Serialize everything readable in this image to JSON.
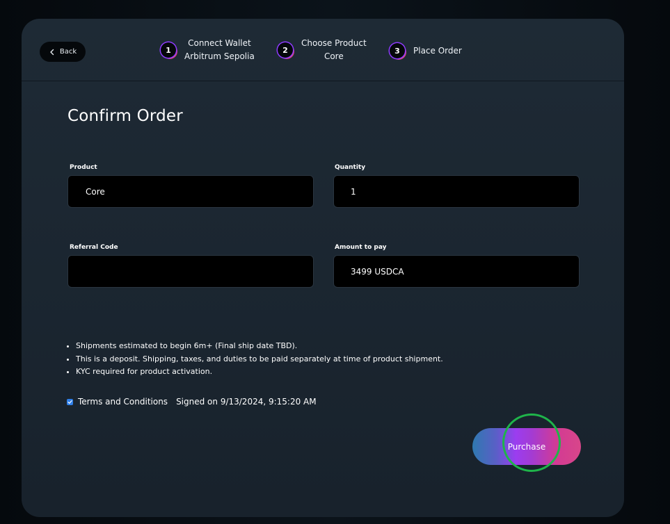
{
  "header": {
    "back_label": "Back",
    "steps": [
      {
        "number": "1",
        "line1": "Connect Wallet",
        "line2": "Arbitrum Sepolia"
      },
      {
        "number": "2",
        "line1": "Choose Product",
        "line2": "Core"
      },
      {
        "number": "3",
        "line1": "Place Order",
        "line2": ""
      }
    ]
  },
  "form": {
    "title": "Confirm Order",
    "product": {
      "label": "Product",
      "value": "Core"
    },
    "quantity": {
      "label": "Quantity",
      "value": "1"
    },
    "referral": {
      "label": "Referral Code",
      "value": ""
    },
    "amount": {
      "label": "Amount to pay",
      "value": "3499 USDCA"
    }
  },
  "notes": [
    "Shipments estimated to begin 6m+ (Final ship date TBD).",
    "This is a deposit. Shipping, taxes, and duties to be paid separately at time of product shipment.",
    "KYC required for product activation."
  ],
  "terms": {
    "label": "Terms and Conditions",
    "signed": "Signed on 9/13/2024, 9:15:20 AM",
    "checked": true
  },
  "purchase_label": "Purchase",
  "colors": {
    "accent_purple": "#9b3df0",
    "accent_pink": "#d8468a",
    "accent_blue": "#2f79b0",
    "highlight_green": "#1fb44a",
    "checkbox_blue": "#2f7fe8"
  }
}
